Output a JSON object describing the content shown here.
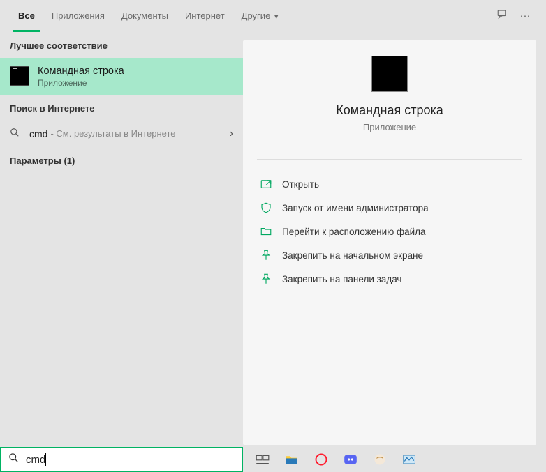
{
  "tabs": {
    "all": "Все",
    "apps": "Приложения",
    "docs": "Документы",
    "internet": "Интернет",
    "other": "Другие"
  },
  "sections": {
    "best_match": "Лучшее соответствие",
    "web_search": "Поиск в Интернете",
    "settings": "Параметры (1)"
  },
  "best_match": {
    "title": "Командная строка",
    "subtitle": "Приложение"
  },
  "web": {
    "query": "cmd",
    "hint": "- См. результаты в Интернете"
  },
  "preview": {
    "title": "Командная строка",
    "subtitle": "Приложение"
  },
  "actions": {
    "open": "Открыть",
    "run_admin": "Запуск от имени администратора",
    "open_location": "Перейти к расположению файла",
    "pin_start": "Закрепить на начальном экране",
    "pin_taskbar": "Закрепить на панели задач"
  },
  "search": {
    "value": "cmd"
  }
}
